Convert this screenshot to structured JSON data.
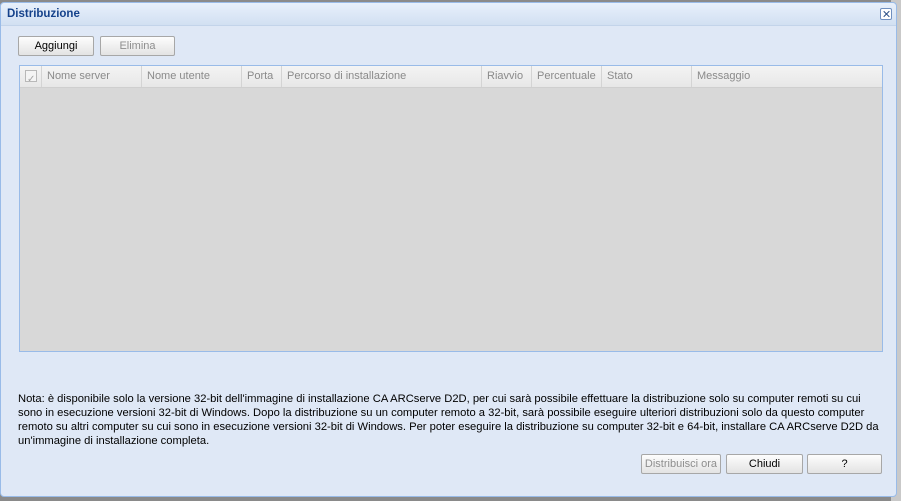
{
  "dialog": {
    "title": "Distribuzione"
  },
  "toolbar": {
    "add_label": "Aggiungi",
    "delete_label": "Elimina"
  },
  "grid": {
    "columns": [
      "Nome server",
      "Nome utente",
      "Porta",
      "Percorso di installazione",
      "Riavvio",
      "Percentuale",
      "Stato",
      "Messaggio"
    ],
    "rows": []
  },
  "note": "Nota: è disponibile solo la versione 32-bit dell'immagine di installazione CA ARCserve D2D, per cui sarà possibile effettuare la distribuzione solo su computer remoti su cui sono in esecuzione versioni 32-bit di Windows. Dopo la distribuzione su un computer remoto a 32-bit, sarà possibile eseguire ulteriori distribuzioni solo da questo computer remoto su altri computer su cui sono in esecuzione versioni 32-bit di Windows. Per poter eseguire la distribuzione su computer 32-bit e 64-bit, installare CA ARCserve D2D da un'immagine di installazione completa.",
  "footer": {
    "deploy_label": "Distribuisci ora",
    "close_label": "Chiudi",
    "help_label": "?"
  },
  "icons": {
    "close": "close-icon",
    "select_all": "checkbox-icon"
  }
}
